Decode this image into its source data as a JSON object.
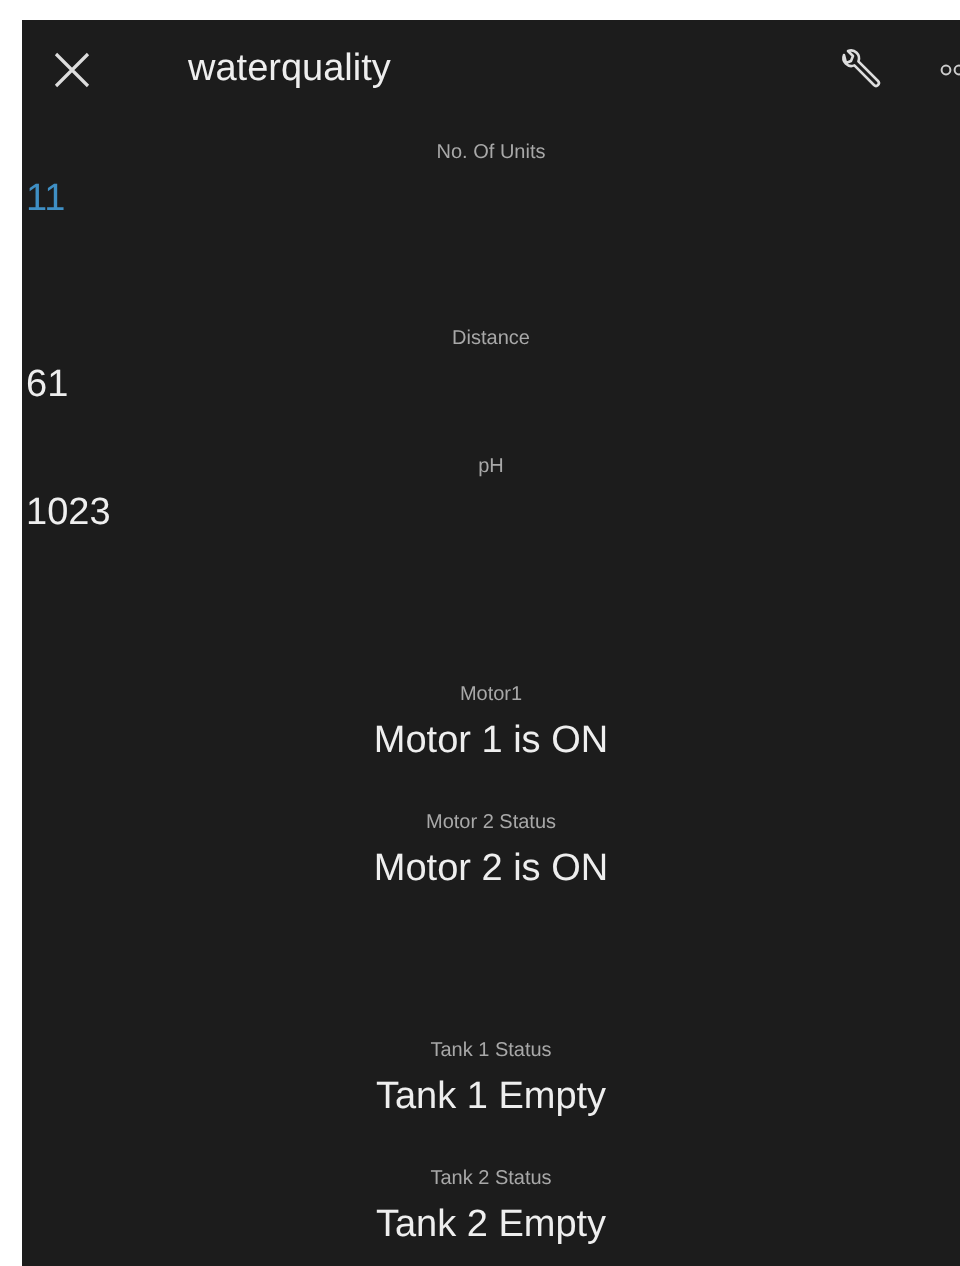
{
  "header": {
    "title": "waterquality"
  },
  "sections": [
    {
      "widgets": [
        {
          "kind": "value",
          "label": "No. Of Units",
          "value": "11",
          "color": "#3f8fc4"
        }
      ]
    },
    {
      "widgets": [
        {
          "kind": "value",
          "label": "Distance",
          "value": "61",
          "color": "#eeeeee"
        },
        {
          "kind": "value",
          "label": "pH",
          "value": "1023",
          "color": "#eeeeee"
        }
      ]
    },
    {
      "widgets": [
        {
          "kind": "status",
          "label": "Motor1",
          "value": "Motor 1 is ON"
        },
        {
          "kind": "status",
          "label": "Motor 2 Status",
          "value": "Motor 2 is ON"
        }
      ]
    },
    {
      "widgets": [
        {
          "kind": "status",
          "label": "Tank 1 Status",
          "value": "Tank 1 Empty"
        },
        {
          "kind": "status",
          "label": "Tank 2 Status",
          "value": "Tank 2 Empty"
        }
      ]
    }
  ]
}
